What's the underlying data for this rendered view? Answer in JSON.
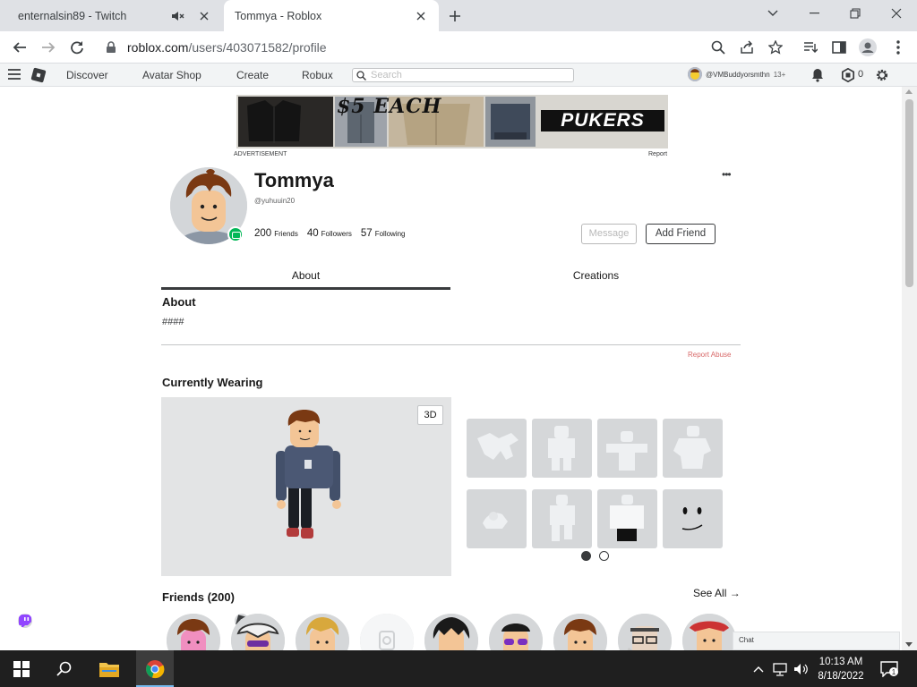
{
  "browser": {
    "tabs": [
      {
        "title": "enternalsin89 - Twitch",
        "icon": "twitch-icon",
        "active": false
      },
      {
        "title": "Tommya - Roblox",
        "icon": "roblox-icon",
        "active": true
      }
    ],
    "url_host": "roblox.com",
    "url_path": "/users/403071582/profile"
  },
  "rbx_nav": {
    "links": [
      "Discover",
      "Avatar Shop",
      "Create",
      "Robux"
    ],
    "search_placeholder": "Search",
    "username": "@VMBuddyorsmthn",
    "age_badge": "13+",
    "robux_count": "0"
  },
  "ad": {
    "headline": "$5 EACH",
    "brand": "PUKERS",
    "label": "ADVERTISEMENT",
    "report": "Report"
  },
  "profile": {
    "display_name": "Tommya",
    "handle": "@yuhuuin20",
    "friends_count": "200",
    "friends_label": "Friends",
    "followers_count": "40",
    "followers_label": "Followers",
    "following_count": "57",
    "following_label": "Following",
    "message_label": "Message",
    "add_friend_label": "Add Friend",
    "more_label": "•••"
  },
  "tabs": [
    "About",
    "Creations"
  ],
  "about": {
    "heading": "About",
    "text": "####",
    "report_abuse": "Report Abuse"
  },
  "wearing": {
    "heading": "Currently Wearing",
    "toggle_3d": "3D",
    "items_count_visible": 8,
    "page_dots": 2,
    "active_page": 1
  },
  "friends": {
    "heading": "Friends (200)",
    "see_all": "See All →"
  },
  "chat_label": "Chat",
  "taskbar": {
    "time": "10:13 AM",
    "date": "8/18/2022",
    "notification_count": "1"
  },
  "colors": {
    "online": "#02b757",
    "report_abuse": "#d86868",
    "twitch": "#9146ff",
    "taskbar": "#1f1f1f"
  }
}
